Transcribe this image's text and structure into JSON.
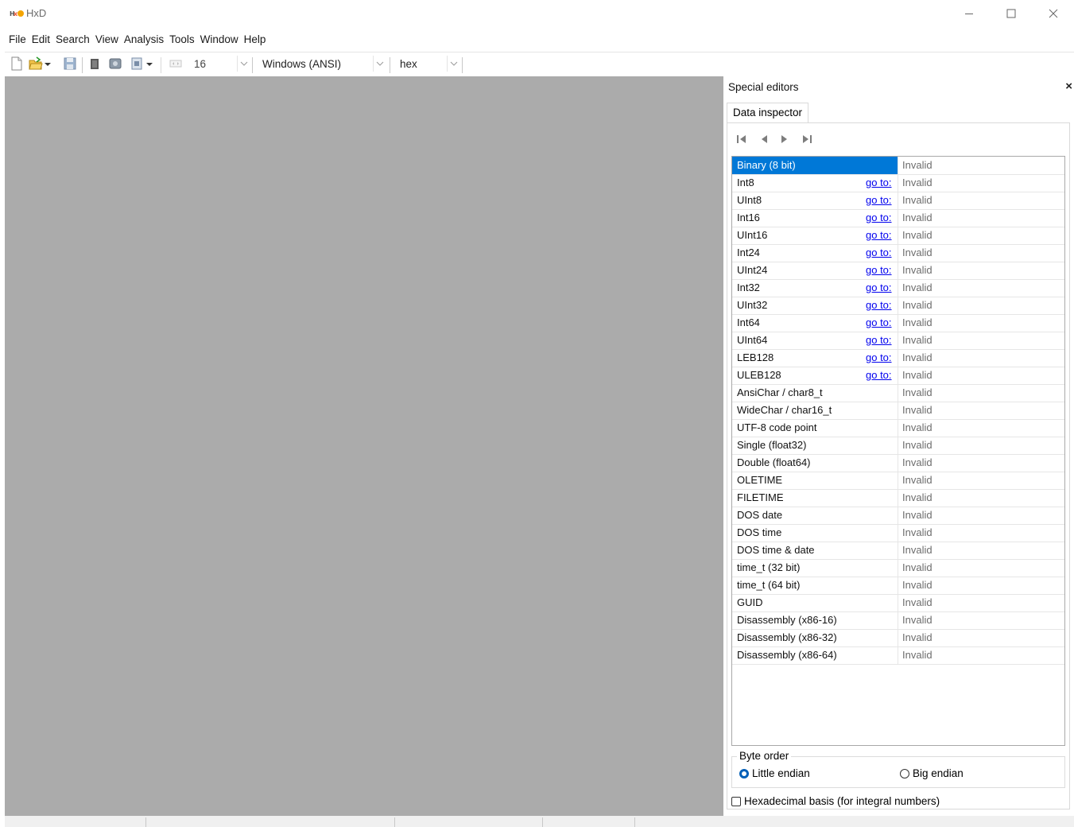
{
  "window": {
    "title": "HxD",
    "minimize_icon": "minimize-icon",
    "maximize_icon": "maximize-icon",
    "close_icon": "close-icon"
  },
  "menu": [
    "File",
    "Edit",
    "Search",
    "View",
    "Analysis",
    "Tools",
    "Window",
    "Help"
  ],
  "toolbar": {
    "bytes_per_row": "16",
    "charset": "Windows (ANSI)",
    "offset_base": "hex",
    "icons": [
      "new-file-icon",
      "open-file-icon",
      "save-icon",
      "close-file-icon",
      "open-disk-icon",
      "open-ram-icon",
      "offset-width-icon"
    ]
  },
  "special_editors": {
    "title": "Special editors",
    "close_label": "×",
    "tab": "Data inspector",
    "nav_icons": [
      "first-icon",
      "previous-icon",
      "next-icon",
      "last-icon"
    ],
    "goto_label": "go to:",
    "rows": [
      {
        "name": "Binary (8 bit)",
        "value": "Invalid",
        "goto": false,
        "selected": true
      },
      {
        "name": "Int8",
        "value": "Invalid",
        "goto": true
      },
      {
        "name": "UInt8",
        "value": "Invalid",
        "goto": true
      },
      {
        "name": "Int16",
        "value": "Invalid",
        "goto": true
      },
      {
        "name": "UInt16",
        "value": "Invalid",
        "goto": true
      },
      {
        "name": "Int24",
        "value": "Invalid",
        "goto": true
      },
      {
        "name": "UInt24",
        "value": "Invalid",
        "goto": true
      },
      {
        "name": "Int32",
        "value": "Invalid",
        "goto": true
      },
      {
        "name": "UInt32",
        "value": "Invalid",
        "goto": true
      },
      {
        "name": "Int64",
        "value": "Invalid",
        "goto": true
      },
      {
        "name": "UInt64",
        "value": "Invalid",
        "goto": true
      },
      {
        "name": "LEB128",
        "value": "Invalid",
        "goto": true
      },
      {
        "name": "ULEB128",
        "value": "Invalid",
        "goto": true
      },
      {
        "name": "AnsiChar / char8_t",
        "value": "Invalid",
        "goto": false
      },
      {
        "name": "WideChar / char16_t",
        "value": "Invalid",
        "goto": false
      },
      {
        "name": "UTF-8 code point",
        "value": "Invalid",
        "goto": false
      },
      {
        "name": "Single (float32)",
        "value": "Invalid",
        "goto": false
      },
      {
        "name": "Double (float64)",
        "value": "Invalid",
        "goto": false
      },
      {
        "name": "OLETIME",
        "value": "Invalid",
        "goto": false
      },
      {
        "name": "FILETIME",
        "value": "Invalid",
        "goto": false
      },
      {
        "name": "DOS date",
        "value": "Invalid",
        "goto": false
      },
      {
        "name": "DOS time",
        "value": "Invalid",
        "goto": false
      },
      {
        "name": "DOS time & date",
        "value": "Invalid",
        "goto": false
      },
      {
        "name": "time_t (32 bit)",
        "value": "Invalid",
        "goto": false
      },
      {
        "name": "time_t (64 bit)",
        "value": "Invalid",
        "goto": false
      },
      {
        "name": "GUID",
        "value": "Invalid",
        "goto": false
      },
      {
        "name": "Disassembly (x86-16)",
        "value": "Invalid",
        "goto": false
      },
      {
        "name": "Disassembly (x86-32)",
        "value": "Invalid",
        "goto": false
      },
      {
        "name": "Disassembly (x86-64)",
        "value": "Invalid",
        "goto": false
      }
    ],
    "byte_order": {
      "label": "Byte order",
      "little_endian": "Little endian",
      "big_endian": "Big endian",
      "selected": "little"
    },
    "hex_basis_label": "Hexadecimal basis (for integral numbers)",
    "hex_basis_checked": false
  },
  "colors": {
    "workspace": "#ababab",
    "selection": "#0078d7",
    "link": "#0000ee"
  }
}
